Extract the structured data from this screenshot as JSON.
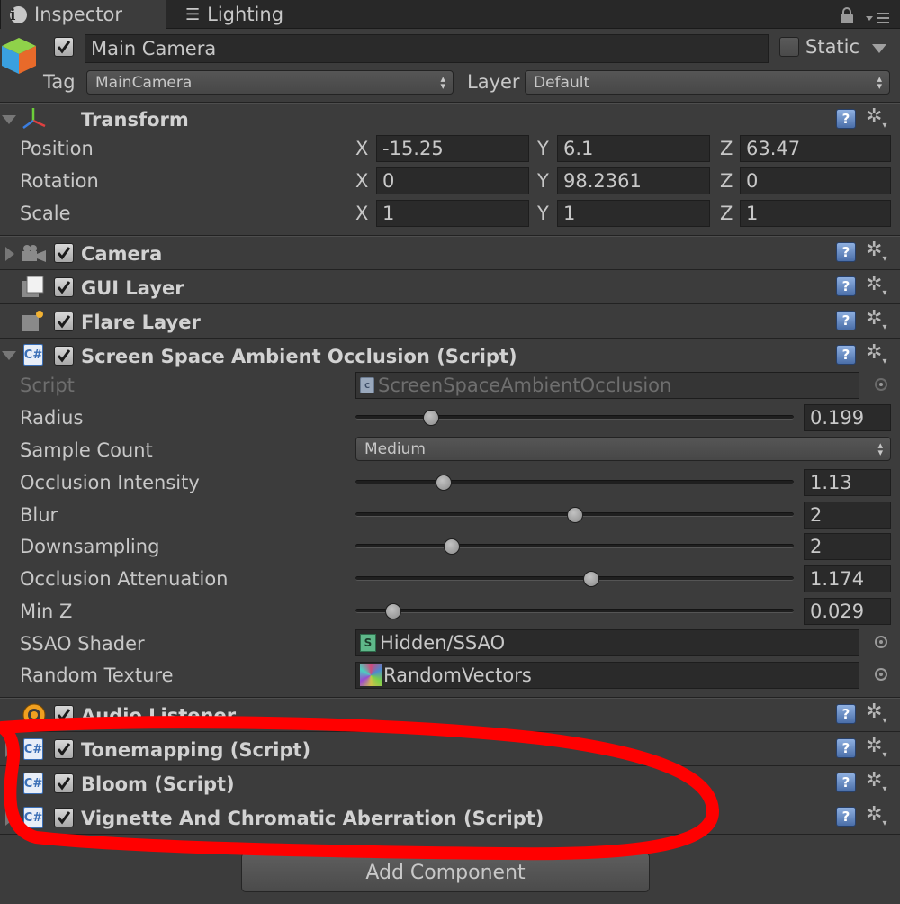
{
  "tabs": {
    "inspector": "Inspector",
    "lighting": "Lighting"
  },
  "header": {
    "object_name": "Main Camera",
    "active": true,
    "static_label": "Static",
    "static_checked": false,
    "tag_label": "Tag",
    "tag_value": "MainCamera",
    "layer_label": "Layer",
    "layer_value": "Default"
  },
  "transform": {
    "title": "Transform",
    "rows": [
      {
        "label": "Position",
        "x": "-15.25",
        "y": "6.1",
        "z": "63.47"
      },
      {
        "label": "Rotation",
        "x": "0",
        "y": "98.2361",
        "z": "0"
      },
      {
        "label": "Scale",
        "x": "1",
        "y": "1",
        "z": "1"
      }
    ],
    "axis": {
      "x": "X",
      "y": "Y",
      "z": "Z"
    }
  },
  "components": {
    "camera": "Camera",
    "gui_layer": "GUI Layer",
    "flare_layer": "Flare Layer",
    "ssao": "Screen Space Ambient Occlusion (Script)",
    "audio_listener": "Audio Listener",
    "tonemapping": "Tonemapping (Script)",
    "bloom": "Bloom (Script)",
    "vignette": "Vignette And Chromatic Aberration (Script)"
  },
  "ssao": {
    "script_label": "Script",
    "script_value": "ScreenSpaceAmbientOcclusion",
    "radius_label": "Radius",
    "radius_value": "0.199",
    "radius_level": 0.16,
    "sample_count_label": "Sample Count",
    "sample_count_value": "Medium",
    "occlusion_intensity_label": "Occlusion Intensity",
    "occlusion_intensity_value": "1.13",
    "occlusion_intensity_level": 0.19,
    "blur_label": "Blur",
    "blur_value": "2",
    "blur_level": 0.5,
    "downsampling_label": "Downsampling",
    "downsampling_value": "2",
    "downsampling_level": 0.21,
    "occlusion_attenuation_label": "Occlusion Attenuation",
    "occlusion_attenuation_value": "1.174",
    "occlusion_attenuation_level": 0.54,
    "min_z_label": "Min Z",
    "min_z_value": "0.029",
    "min_z_level": 0.07,
    "shader_label": "SSAO Shader",
    "shader_value": "Hidden/SSAO",
    "random_texture_label": "Random Texture",
    "random_texture_value": "RandomVectors"
  },
  "add_component_label": "Add Component",
  "colors": {
    "panel_bg": "#3c3c3c",
    "field_bg": "#2a2a2a",
    "text": "#c8c8c8",
    "annotation_red": "#ff0000"
  }
}
